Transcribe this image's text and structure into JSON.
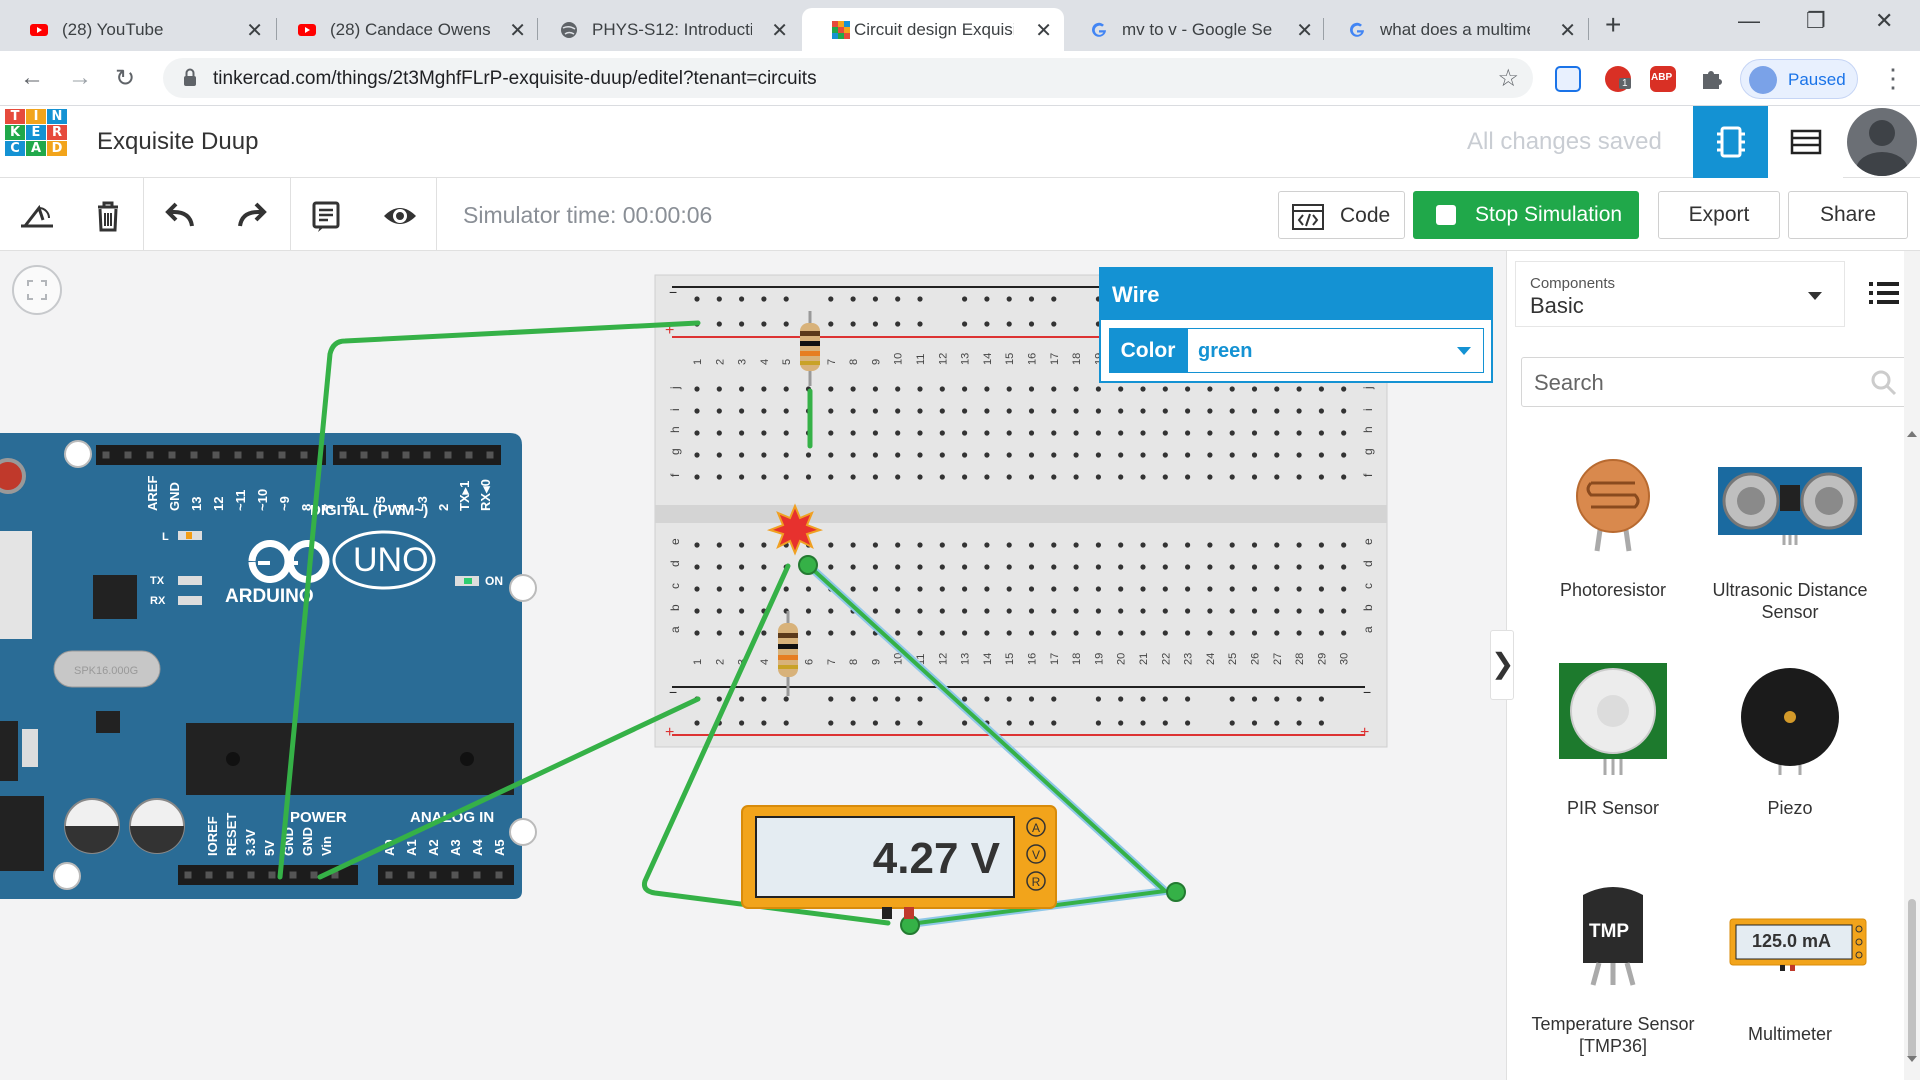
{
  "browser": {
    "tabs": [
      {
        "title": "(28) YouTube",
        "icon": "youtube-icon"
      },
      {
        "title": "(28) Candace Owens",
        "icon": "youtube-icon"
      },
      {
        "title": "PHYS-S12: Introducti",
        "icon": "globe-icon"
      },
      {
        "title": "Circuit design Exquisi",
        "icon": "tinkercad-icon"
      },
      {
        "title": "mv to v - Google Sea",
        "icon": "google-icon"
      },
      {
        "title": "what does a multime",
        "icon": "google-icon"
      }
    ],
    "url": "tinkercad.com/things/2t3MghfFLrP-exquisite-duup/editel?tenant=circuits",
    "profile_label": "Paused",
    "extension_badge": "1",
    "abp_label": "ABP"
  },
  "header": {
    "logo_letters": [
      "T",
      "I",
      "N",
      "K",
      "E",
      "R",
      "C",
      "A",
      "D"
    ],
    "project_name": "Exquisite Duup",
    "save_status": "All changes saved"
  },
  "toolbar": {
    "sim_time": "Simulator time: 00:00:06",
    "code_label": "Code",
    "stop_label": "Stop Simulation",
    "export_label": "Export",
    "share_label": "Share"
  },
  "inspector": {
    "title": "Wire",
    "color_label": "Color",
    "color_value": "green"
  },
  "canvas": {
    "multimeter_reading": "4.27 V",
    "multimeter_modes": [
      "A",
      "V",
      "R"
    ],
    "arduino": {
      "brand": "ARDUINO",
      "model": "UNO",
      "digital_label": "DIGITAL (PWM~)",
      "power_label": "POWER",
      "analog_label": "ANALOG IN",
      "on_label": "ON",
      "l_label": "L",
      "tx_label": "TX",
      "rx_label": "RX",
      "top_pins": [
        "AREF",
        "GND",
        "13",
        "12",
        "~11",
        "~10",
        "~9",
        "8",
        "7",
        "~6",
        "~5",
        "4",
        "~3",
        "2",
        "TX▸1",
        "RX◂0"
      ],
      "power_pins": [
        "IOREF",
        "RESET",
        "3.3V",
        "5V",
        "GND",
        "GND",
        "Vin"
      ],
      "analog_pins": [
        "A0",
        "A1",
        "A2",
        "A3",
        "A4",
        "A5"
      ],
      "crystal": "SPK16.000G"
    },
    "breadboard": {
      "rows_top": [
        "j",
        "i",
        "h",
        "g",
        "f"
      ],
      "rows_bottom": [
        "e",
        "d",
        "c",
        "b",
        "a"
      ],
      "columns": 30
    }
  },
  "components": {
    "category_label": "Components",
    "category_value": "Basic",
    "search_placeholder": "Search",
    "items": [
      {
        "name": "Photoresistor"
      },
      {
        "name": "Ultrasonic Distance Sensor"
      },
      {
        "name": "PIR Sensor"
      },
      {
        "name": "Piezo"
      },
      {
        "name": "Temperature Sensor [TMP36]"
      },
      {
        "name": "Multimeter"
      }
    ],
    "tmp_label": "TMP",
    "multimeter_reading": "125.0 mA"
  },
  "colors": {
    "brand_blue": "#1492d3",
    "sim_green": "#20a84a",
    "wire_green": "#35b147",
    "arduino_blue": "#2a6c96",
    "multimeter_orange": "#f2a41b"
  }
}
